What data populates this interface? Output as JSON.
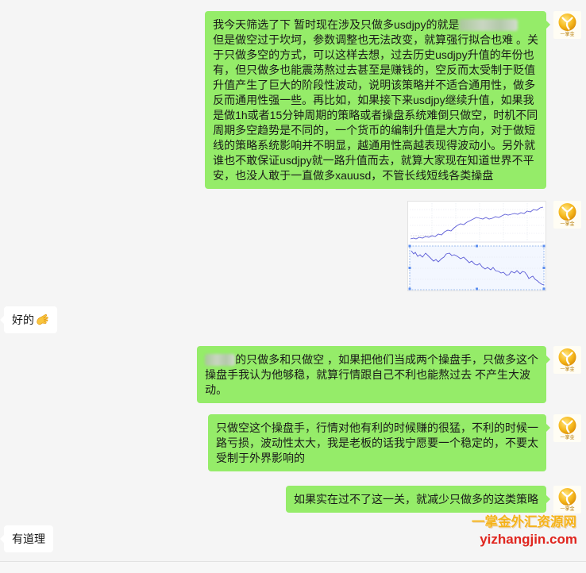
{
  "theme": {
    "window_bg": "#f5f5f5",
    "self_bubble": "#95ec69",
    "other_bubble": "#ffffff",
    "text_color": "#191919"
  },
  "avatar": {
    "logo_text": "一掌金",
    "icon": "yizhangjin-logo-icon"
  },
  "messages": [
    {
      "outgoing": true,
      "lines": [
        "我今天筛选了下 暂时现在涉及只做多usdjpy的就是",
        "但是做空过于坎坷，参数调整也无法改变，就算强行拟合也难 。关",
        "于只做多空的方式，可以这样去想，过去历史usdjpy升值的年份也",
        "有，但只做多也能震荡熬过去甚至是赚钱的，空反而太受制于贬值",
        "升值产生了巨大的阶段性波动，说明该策略并不适合通用性，做多",
        "反而通用性强一些。再比如，如果接下来usdjpy继续升值，如果我",
        "是做1h或者15分钟周期的策略或者操盘系统难倒只做空，时机不同",
        "周期多空趋势是不同的，一个货币的编制升值是大方向，对于做短",
        "线的策略系统影响并不明显，越通用性高越表现得波动小。另外就",
        "谁也不敢保证usdjpy就一路升值而去，就算大家现在知道世界不平",
        "安，也没人敢于一直做多xauusd，不管长线短线各类操盘"
      ]
    },
    {
      "outgoing": true,
      "image": {
        "icon": "chart-screenshot-image"
      }
    },
    {
      "outgoing": false,
      "lines": [
        "好的"
      ],
      "emoji_icon": "ok-hand-emoji-icon"
    },
    {
      "outgoing": true,
      "lines": [
        "的只做多和只做空 ，如果把他们当成两个操盘手，只做多这个",
        "操盘手我认为他够稳，就算行情跟自己不利也能熬过去 不产生大波",
        "动。"
      ]
    },
    {
      "outgoing": true,
      "lines": [
        "只做空这个操盘手，行情对他有利的时候赚的很猛，不利的时候一",
        "路亏损，波动性太大，我是老板的话我宁愿要一个稳定的，不要太",
        "受制于外界影响的"
      ]
    },
    {
      "outgoing": true,
      "lines": [
        "如果实在过不了这一关，就减少只做多的这类策略"
      ]
    },
    {
      "outgoing": false,
      "lines": [
        "有道理"
      ]
    }
  ],
  "watermark": {
    "site_name": "一掌金外汇资源网",
    "url": "yizhangjin.com",
    "name_color": "#f4b21a",
    "url_color": "#e0261f"
  }
}
